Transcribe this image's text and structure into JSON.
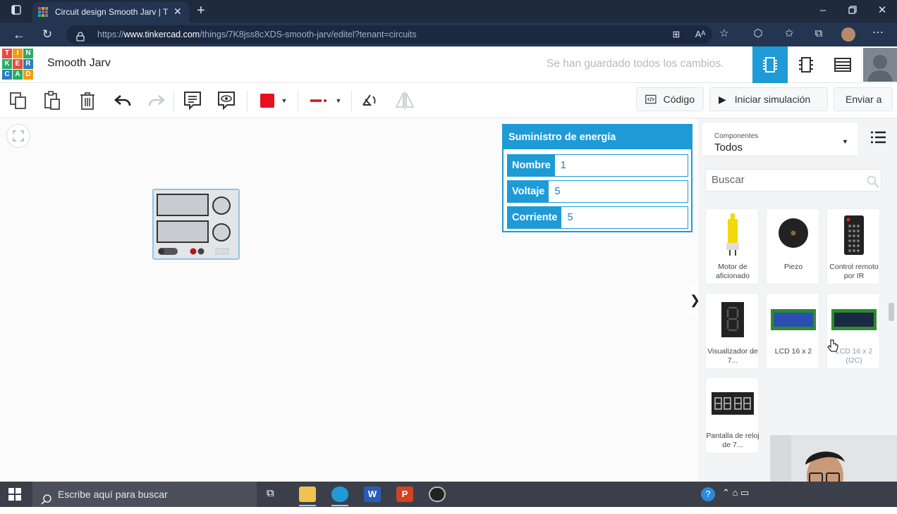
{
  "browser": {
    "tab_title": "Circuit design Smooth Jarv | Tinkercad",
    "url_prefix": "https://",
    "url_host": "www.tinkercad.com",
    "url_path": "/things/7K8jss8cXDS-smooth-jarv/editel?tenant=circuits"
  },
  "app": {
    "logo_letters": [
      "T",
      "I",
      "N",
      "K",
      "E",
      "R",
      "C",
      "A",
      "D"
    ],
    "project_title": "Smooth Jarv",
    "save_status": "Se han guardado todos los cambios."
  },
  "toolbar": {
    "code_label": "Código",
    "simulate_label": "Iniciar simulación",
    "send_label": "Enviar a",
    "fill_color": "#e8101e",
    "wire_color": "#c41a1a"
  },
  "inspector": {
    "title": "Suministro de energía",
    "fields": [
      {
        "label": "Nombre",
        "value": "1"
      },
      {
        "label": "Voltaje",
        "value": "5"
      },
      {
        "label": "Corriente",
        "value": "5"
      }
    ]
  },
  "components_panel": {
    "select_caption": "Componentes",
    "select_value": "Todos",
    "search_placeholder": "Buscar",
    "items": [
      {
        "label": "Motor de aficionado"
      },
      {
        "label": "Piezo"
      },
      {
        "label": "Control remoto por IR"
      },
      {
        "label": "Visualizador de 7..."
      },
      {
        "label": "LCD 16 x 2"
      },
      {
        "label": "LCD 16 x 2 (I2C)"
      },
      {
        "label": "Pantalla de reloj de 7..."
      }
    ]
  },
  "taskbar": {
    "search_placeholder": "Escribe aquí para buscar"
  },
  "colors": {
    "accent": "#1e9bd7",
    "browser_dark": "#1f2a3c"
  }
}
